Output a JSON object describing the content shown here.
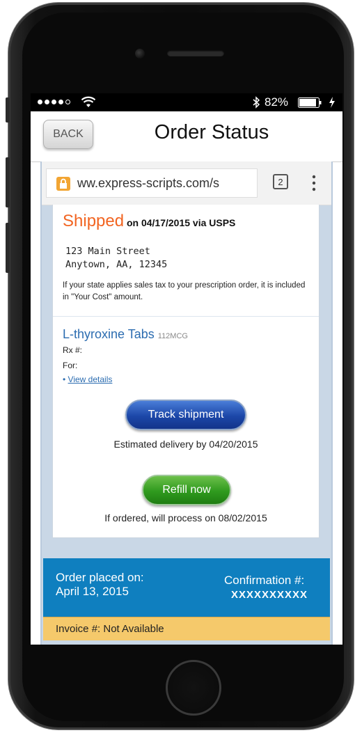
{
  "status_bar": {
    "battery_percent": "82%",
    "signal_bars_filled": 4,
    "signal_bars_total": 5
  },
  "nav": {
    "back_label": "BACK",
    "title": "Order Status"
  },
  "browser": {
    "url": "ww.express-scripts.com/s",
    "tab_count": "2"
  },
  "shipment": {
    "status_word": "Shipped",
    "status_detail": " on 04/17/2015 via USPS",
    "address_line1": "123 Main Street",
    "address_line2": "Anytown, AA, 12345",
    "tax_note": "If your state applies sales tax to your prescription order, it is included in \"Your Cost\" amount."
  },
  "prescription": {
    "drug_name": "L-thyroxine Tabs",
    "strength": "112MCG",
    "rx_label": "Rx #:",
    "for_label": "For:",
    "bullet": "•",
    "view_details": "View details",
    "track_label": "Track shipment",
    "estimated_delivery": "Estimated delivery by 04/20/2015",
    "refill_label": "Refill now",
    "refill_note": "If ordered, will process on 08/02/2015"
  },
  "order": {
    "placed_label": "Order placed on:",
    "placed_date": "April 13, 2015",
    "confirmation_label": "Confirmation #:",
    "confirmation_value": "XXXXXXXXXX",
    "invoice_text": "Invoice #: Not Available"
  },
  "colors": {
    "shipped": "#f26522",
    "link": "#2b6cb0",
    "order_panel": "#0f7fbf",
    "invoice_panel": "#f5c96b",
    "track_button": "#1c47a8",
    "refill_button": "#2f9a1e"
  },
  "icons": [
    "wifi-icon",
    "bluetooth-icon",
    "battery-icon",
    "charging-icon",
    "lock-icon",
    "tabs-icon",
    "more-vert-icon"
  ]
}
